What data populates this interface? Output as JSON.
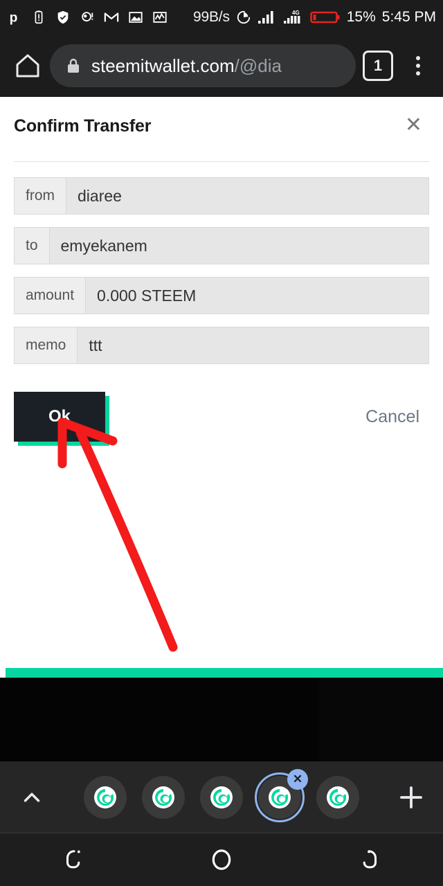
{
  "status_bar": {
    "icons": [
      "opera-icon",
      "battery-alert-icon",
      "shield-check-icon",
      "alert-dot-icon",
      "gmail-icon",
      "image-icon",
      "activity-chart-icon"
    ],
    "network_speed": "99B/s",
    "data_icon": "data-usage-pie-icon",
    "signal_1": "signal-bars-icon",
    "signal_2": "signal-bars-4g-icon",
    "network_type": "4G",
    "battery_icon": "battery-low-icon",
    "battery_level": "15%",
    "clock": "5:45 PM"
  },
  "browser": {
    "home_icon": "home-icon",
    "lock_icon": "lock-icon",
    "url_domain": "steemitwallet.com",
    "url_path": "/@dia",
    "url_full": "steemitwallet.com/@dia",
    "tab_count": "1",
    "menu_icon": "overflow-menu-icon"
  },
  "dialog": {
    "title": "Confirm Transfer",
    "close_icon": "close-icon",
    "fields": [
      {
        "label": "from",
        "value": "diaree"
      },
      {
        "label": "to",
        "value": "emyekanem"
      },
      {
        "label": "amount",
        "value": "0.000 STEEM"
      },
      {
        "label": "memo",
        "value": "ttt"
      }
    ],
    "ok_label": "Ok",
    "cancel_label": "Cancel"
  },
  "annotation": {
    "type": "hand-drawn-arrow",
    "color": "#f31b1b",
    "points_at": "ok-button"
  },
  "tab_strip": {
    "collapse_icon": "chevron-up-icon",
    "new_tab_icon": "plus-icon",
    "tabs": [
      {
        "icon": "steemit-favicon",
        "active": false
      },
      {
        "icon": "steemit-favicon",
        "active": false
      },
      {
        "icon": "steemit-favicon",
        "active": false
      },
      {
        "icon": "steemit-favicon",
        "active": true,
        "close_icon": "close-tab-icon"
      },
      {
        "icon": "steemit-favicon",
        "active": false
      }
    ]
  },
  "nav_bar": {
    "back_icon": "back-icon",
    "home_icon": "home-circle-icon",
    "recents_icon": "recents-icon"
  },
  "colors": {
    "accent_teal": "#07d6a0",
    "button_dark": "#1b2026",
    "annotation_red": "#f31b1b",
    "tab_ring_blue": "#8fb4ef",
    "chrome_dark": "#1c1c1c"
  }
}
